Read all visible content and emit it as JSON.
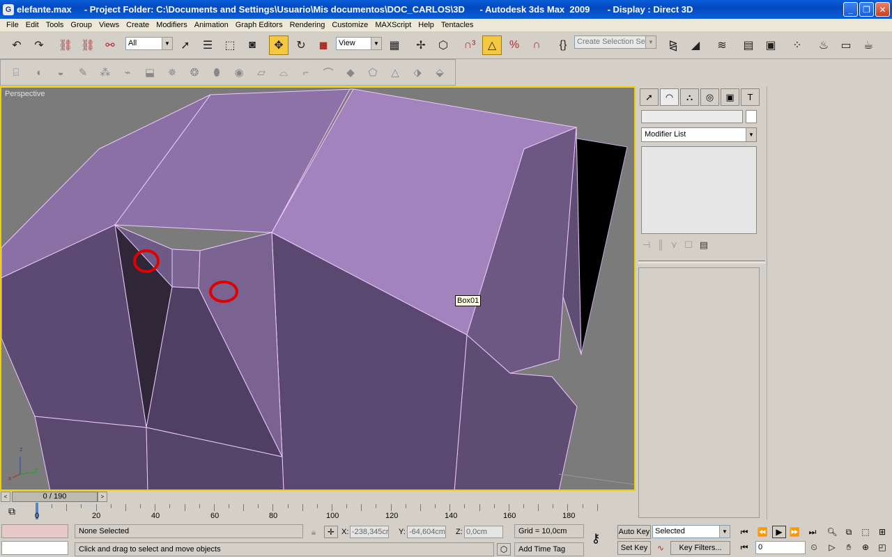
{
  "window": {
    "title": "elefante.max     - Project Folder: C:\\Documents and Settings\\Usuario\\Mis documentos\\DOC_CARLOS\\3D      - Autodesk 3ds Max  2009       - Display : Direct 3D",
    "icon_letter": "G"
  },
  "menu": [
    "File",
    "Edit",
    "Tools",
    "Group",
    "Views",
    "Create",
    "Modifiers",
    "Animation",
    "Graph Editors",
    "Rendering",
    "Customize",
    "MAXScript",
    "Help",
    "Tentacles"
  ],
  "toolbar": {
    "selection_filter": "All",
    "reference_coord": "View",
    "named_selection_placeholder": "Create Selection Set"
  },
  "viewport": {
    "label": "Perspective",
    "object_tooltip": "Box01",
    "axis_x": "x",
    "axis_y": "y",
    "axis_z": "z",
    "object_color": "#a987c0"
  },
  "command_panel": {
    "modifier_list": "Modifier List"
  },
  "timeline": {
    "frame_display": "0 / 190",
    "ticks": [
      "0",
      "20",
      "40",
      "60",
      "80",
      "100",
      "120",
      "140",
      "160",
      "180"
    ]
  },
  "status": {
    "selection": "None Selected",
    "prompt": "Click and drag to select and move objects",
    "x_label": "X:",
    "x_value": "-238,345cr",
    "y_label": "Y:",
    "y_value": "-64,604cm",
    "z_label": "Z:",
    "z_value": "0,0cm",
    "grid": "Grid = 10,0cm",
    "add_time_tag": "Add Time Tag",
    "auto_key": "Auto Key",
    "set_key": "Set Key",
    "key_mode": "Selected",
    "key_filters": "Key Filters...",
    "current_frame": "0"
  }
}
